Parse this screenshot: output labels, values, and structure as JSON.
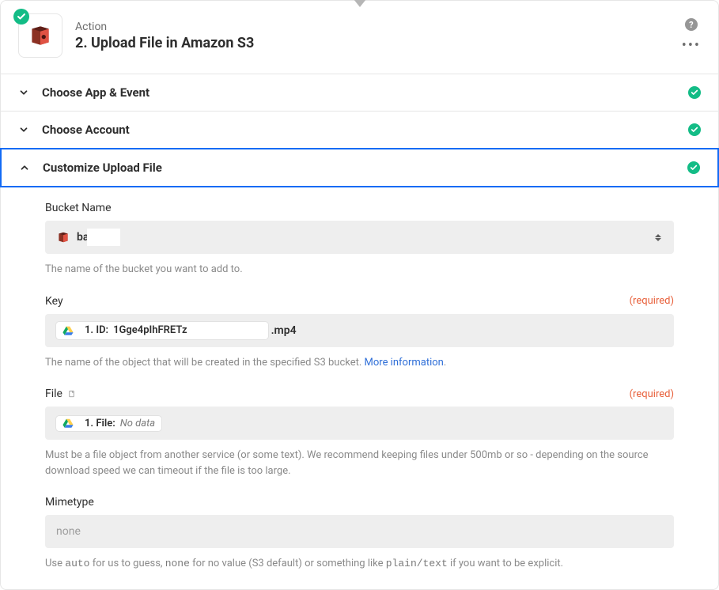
{
  "header": {
    "label": "Action",
    "title": "2. Upload File in Amazon S3"
  },
  "sections": {
    "app_event": {
      "title": "Choose App & Event"
    },
    "account": {
      "title": "Choose Account"
    },
    "customize": {
      "title": "Customize Upload File"
    }
  },
  "fields": {
    "bucket": {
      "label": "Bucket Name",
      "value_prefix": "ba",
      "help": "The name of the bucket you want to add to."
    },
    "key": {
      "label": "Key",
      "required": "(required)",
      "pill_prefix": "1. ID:",
      "pill_value": "1Gge4pIhFRETz",
      "extension": ".mp4",
      "help_pre": "The name of the object that will be created in the specified S3 bucket. ",
      "help_link": "More information",
      "help_post": "."
    },
    "file": {
      "label": "File",
      "required": "(required)",
      "pill_prefix": "1. File:",
      "pill_value": "No data",
      "help": "Must be a file object from another service (or some text). We recommend keeping files under 500mb or so - depending on the source download speed we can timeout if the file is too large."
    },
    "mimetype": {
      "label": "Mimetype",
      "placeholder": "none",
      "help_1": "Use ",
      "help_auto": "auto",
      "help_2": " for us to guess, ",
      "help_none": "none",
      "help_3": " for no value (S3 default) or something like ",
      "help_plain": "plain/text",
      "help_4": " if you want to be explicit."
    }
  }
}
